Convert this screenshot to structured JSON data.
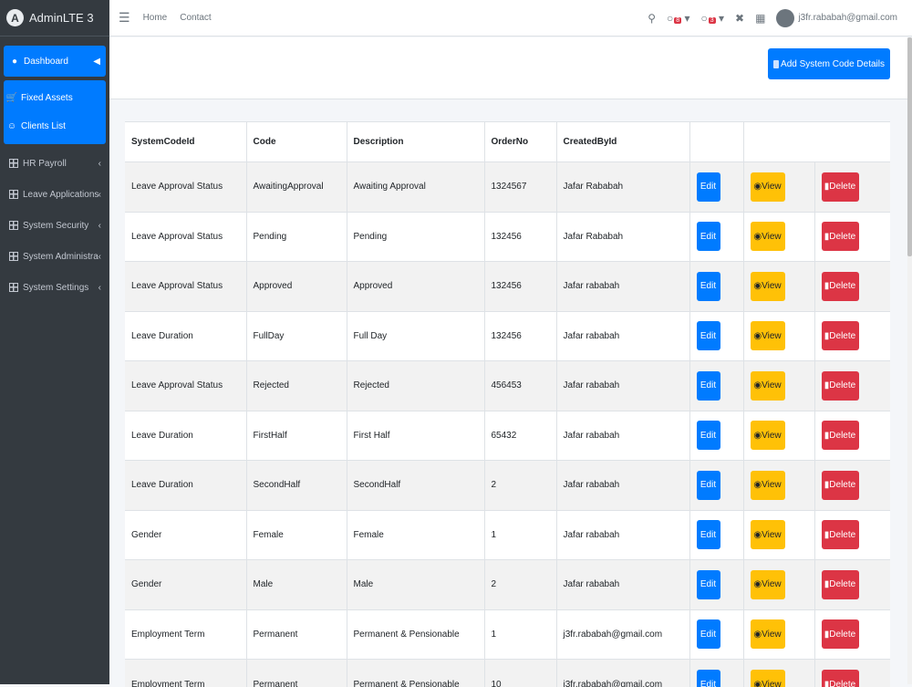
{
  "brand": {
    "logo": "A",
    "name": "AdminLTE 3"
  },
  "topbar": {
    "home": "Home",
    "contact": "Contact",
    "messages_count": "8",
    "notifications_count": "3",
    "user_email": "j3fr.rababah@gmail.com"
  },
  "sidebar": {
    "dashboard": "Dashboard",
    "fixed_assets": "Fixed Assets",
    "clients_list": "Clients List",
    "items": [
      "HR Payroll",
      "Leave Applications",
      "System Security",
      "System Administration",
      "System Settings"
    ]
  },
  "header": {
    "add_button": "Add System Code Details"
  },
  "table": {
    "columns": [
      "SystemCodeId",
      "Code",
      "Description",
      "OrderNo",
      "CreatedById"
    ],
    "edit_label": "Edit",
    "view_label": "View",
    "delete_label": "Delete",
    "rows": [
      [
        "Leave Approval Status",
        "AwaitingApproval",
        "Awaiting Approval",
        "1324567",
        "Jafar Rababah"
      ],
      [
        "Leave Approval Status",
        "Pending",
        "Pending",
        "132456",
        "Jafar Rababah"
      ],
      [
        "Leave Approval Status",
        "Approved",
        "Approved",
        "132456",
        "Jafar rababah"
      ],
      [
        "Leave Duration",
        "FullDay",
        "Full Day",
        "132456",
        "Jafar rababah"
      ],
      [
        "Leave Approval Status",
        "Rejected",
        "Rejected",
        "456453",
        "Jafar rababah"
      ],
      [
        "Leave Duration",
        "FirstHalf",
        "First Half",
        "65432",
        "Jafar rababah"
      ],
      [
        "Leave Duration",
        "SecondHalf",
        "SecondHalf",
        "2",
        "Jafar rababah"
      ],
      [
        "Gender",
        "Female",
        "Female",
        "1",
        "Jafar rababah"
      ],
      [
        "Gender",
        "Male",
        "Male",
        "2",
        "Jafar rababah"
      ],
      [
        "Employment Term",
        "Permanent",
        "Permanent & Pensionable",
        "1",
        "j3fr.rababah@gmail.com"
      ],
      [
        "Employment Term",
        "Permanent",
        "Permanent & Pensionable",
        "10",
        "j3fr.rababah@gmail.com"
      ]
    ]
  }
}
